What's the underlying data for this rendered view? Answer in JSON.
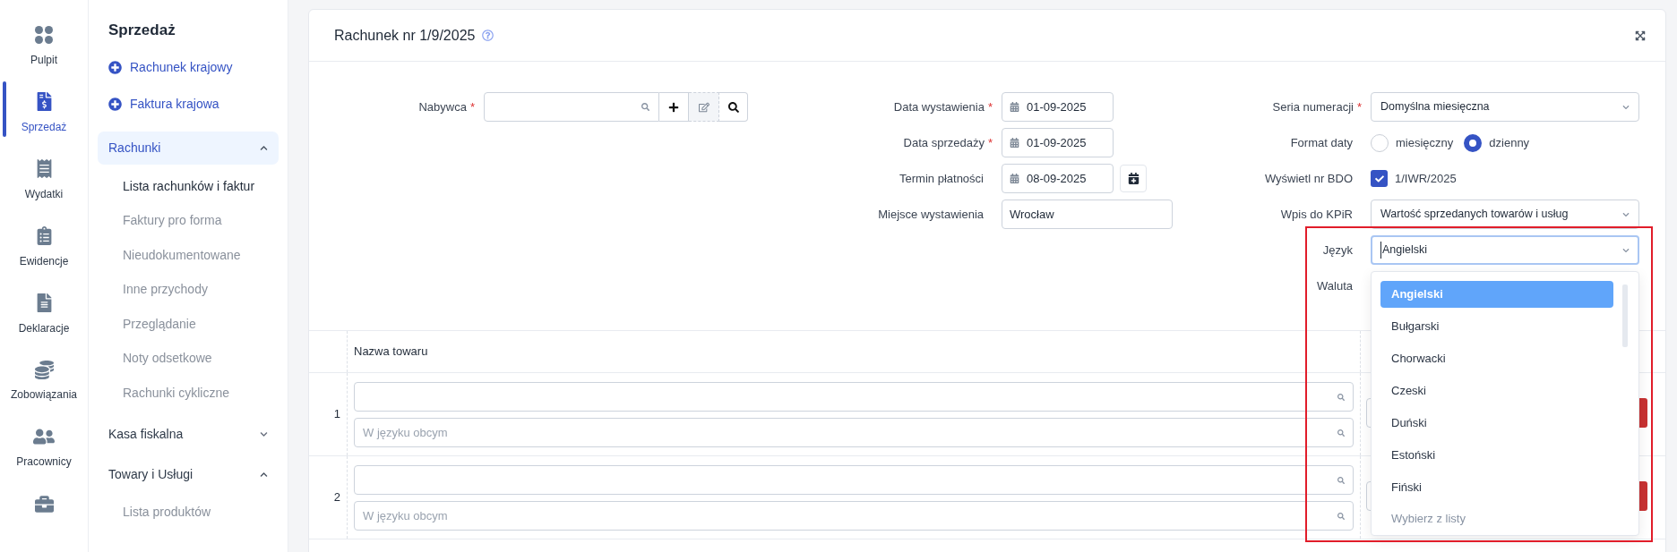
{
  "required_mark": "*",
  "rail": [
    {
      "label": "Pulpit",
      "selected": false
    },
    {
      "label": "Sprzedaż",
      "selected": true
    },
    {
      "label": "Wydatki",
      "selected": false
    },
    {
      "label": "Ewidencje",
      "selected": false
    },
    {
      "label": "Deklaracje",
      "selected": false
    },
    {
      "label": "Zobowiązania",
      "selected": false
    },
    {
      "label": "Pracownicy",
      "selected": false
    },
    {
      "selected": false
    }
  ],
  "nav": {
    "title": "Sprzedaż",
    "actions": [
      "Rachunek krajowy",
      "Faktura krajowa"
    ],
    "groups": [
      {
        "label": "Rachunki",
        "selected": true,
        "expanded": true,
        "children": [
          {
            "label": "Lista rachunków i faktur",
            "selected": true
          },
          {
            "label": "Faktury pro forma",
            "selected": false
          },
          {
            "label": "Nieudokumentowane",
            "selected": false
          },
          {
            "label": "Inne przychody",
            "selected": false
          },
          {
            "label": "Przeglądanie",
            "selected": false
          },
          {
            "label": "Noty odsetkowe",
            "selected": false
          },
          {
            "label": "Rachunki cykliczne",
            "selected": false
          }
        ]
      },
      {
        "label": "Kasa fiskalna",
        "selected": false,
        "expanded": false
      },
      {
        "label": "Towary i Usługi",
        "selected": false,
        "expanded": true,
        "children": [
          {
            "label": "Lista produktów",
            "selected": false
          }
        ]
      }
    ]
  },
  "document": {
    "title": "Rachunek nr 1/9/2025"
  },
  "buyer": {
    "label": "Nabywca",
    "required": true
  },
  "dates": [
    {
      "kind": "date",
      "label": "Data wystawienia",
      "required": true,
      "value": "01-09-2025"
    },
    {
      "kind": "date",
      "label": "Data sprzedaży",
      "required": true,
      "value": "01-09-2025"
    },
    {
      "kind": "date_action",
      "label": "Termin płatności",
      "required": false,
      "value": "08-09-2025"
    },
    {
      "kind": "text",
      "label": "Miejsce wystawienia",
      "required": false,
      "value": "Wrocław"
    }
  ],
  "settings": [
    {
      "kind": "select",
      "label": "Seria numeracji",
      "required": true,
      "value": "Domyślna miesięczna"
    },
    {
      "kind": "radio",
      "label": "Format daty",
      "required": false,
      "options": [
        {
          "label": "miesięczny",
          "selected": false
        },
        {
          "label": "dzienny",
          "selected": true
        }
      ]
    },
    {
      "kind": "checkbox",
      "label": "Wyświetl nr BDO",
      "required": false,
      "checked": true,
      "text": "1/IWR/2025"
    },
    {
      "kind": "select",
      "label": "Wpis do KPiR",
      "required": false,
      "value": "Wartość sprzedanych towarów i usług"
    },
    {
      "kind": "combobox",
      "label": "Język",
      "required": false,
      "value": "Angielski",
      "expanded": true,
      "hint": "Wybierz z listy",
      "options": [
        {
          "label": "Angielski",
          "selected": true
        },
        {
          "label": "Bułgarski",
          "selected": false
        },
        {
          "label": "Chorwacki",
          "selected": false
        },
        {
          "label": "Czeski",
          "selected": false
        },
        {
          "label": "Duński",
          "selected": false
        },
        {
          "label": "Estoński",
          "selected": false
        },
        {
          "label": "Fiński",
          "selected": false
        }
      ]
    },
    {
      "kind": "label",
      "label": "Waluta",
      "required": false
    }
  ],
  "table": {
    "columns": [
      "Nazwa towaru"
    ],
    "rows": [
      {
        "number": "1",
        "foreign_placeholder": "W języku obcym"
      },
      {
        "number": "2",
        "foreign_placeholder": "W języku obcym"
      }
    ]
  }
}
